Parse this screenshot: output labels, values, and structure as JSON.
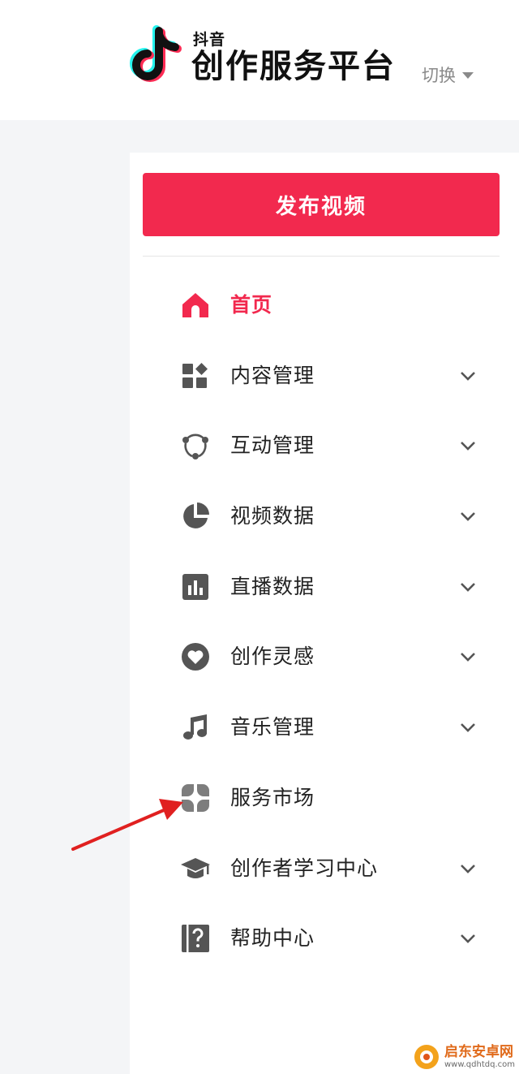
{
  "header": {
    "brand_small": "抖音",
    "brand_title": "创作服务平台",
    "switch_label": "切换",
    "logo_icon": "douyin-note-icon"
  },
  "sidebar": {
    "publish_label": "发布视频",
    "items": [
      {
        "label": "首页",
        "icon": "home-icon",
        "active": true,
        "expandable": false
      },
      {
        "label": "内容管理",
        "icon": "widgets-icon",
        "active": false,
        "expandable": true
      },
      {
        "label": "互动管理",
        "icon": "interaction-icon",
        "active": false,
        "expandable": true
      },
      {
        "label": "视频数据",
        "icon": "pie-chart-icon",
        "active": false,
        "expandable": true
      },
      {
        "label": "直播数据",
        "icon": "bar-chart-icon",
        "active": false,
        "expandable": true
      },
      {
        "label": "创作灵感",
        "icon": "heart-icon",
        "active": false,
        "expandable": true
      },
      {
        "label": "音乐管理",
        "icon": "music-note-icon",
        "active": false,
        "expandable": true
      },
      {
        "label": "服务市场",
        "icon": "clover-icon",
        "active": false,
        "expandable": false
      },
      {
        "label": "创作者学习中心",
        "icon": "graduation-cap-icon",
        "active": false,
        "expandable": true
      },
      {
        "label": "帮助中心",
        "icon": "help-book-icon",
        "active": false,
        "expandable": true
      }
    ]
  },
  "watermark": {
    "name": "启东安卓网",
    "url": "www.qdhtdq.com"
  },
  "colors": {
    "accent": "#f2294e",
    "icon": "#555555",
    "annotation_arrow": "#e02020"
  }
}
